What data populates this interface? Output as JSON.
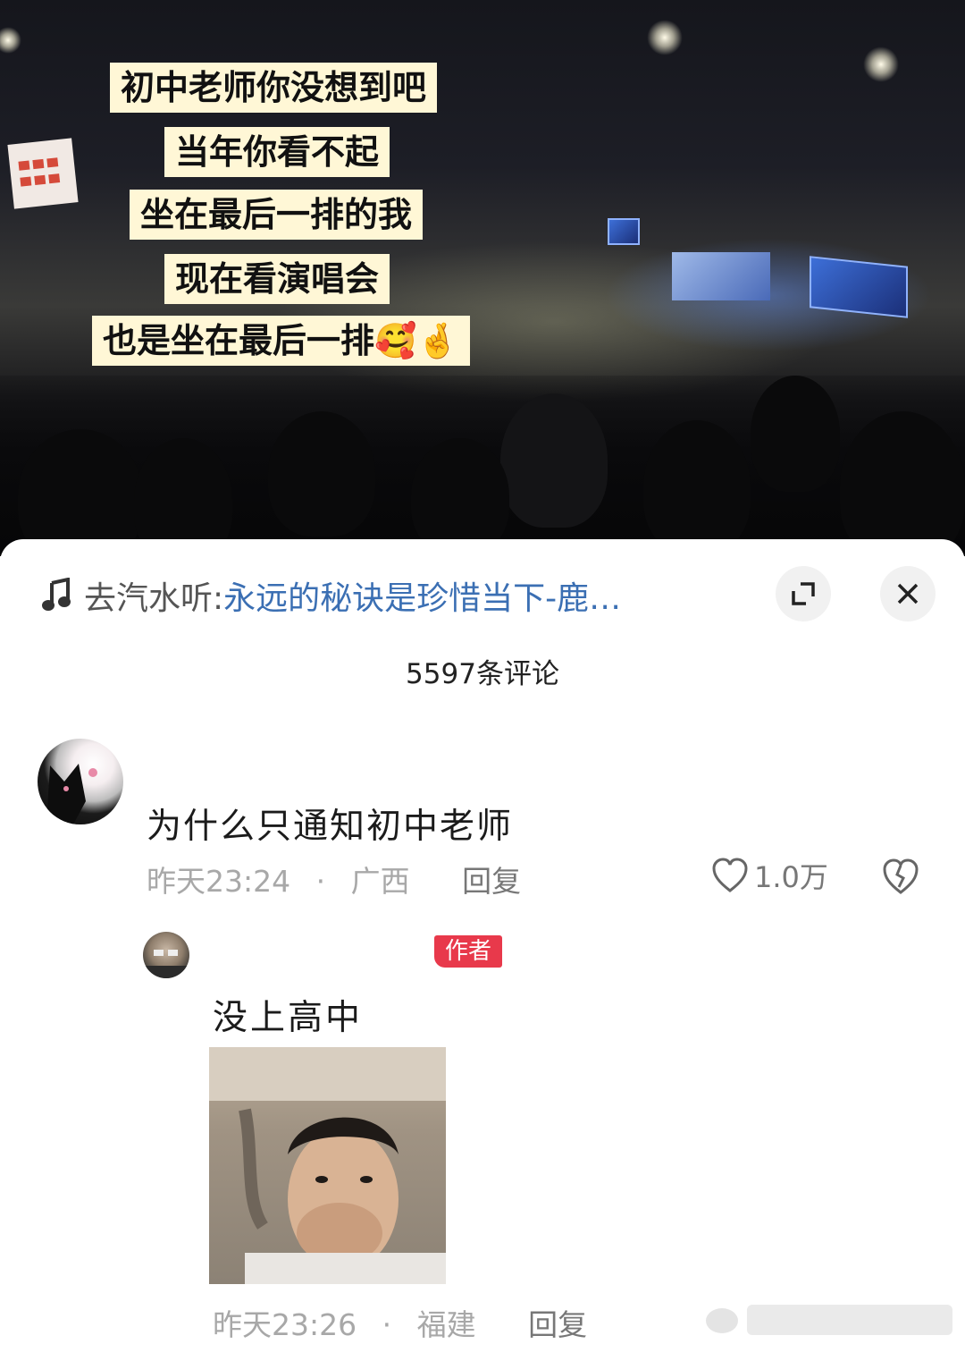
{
  "photo": {
    "captions": [
      "初中老师你没想到吧",
      "当年你看不起",
      "坐在最后一排的我",
      "现在看演唱会",
      "也是坐在最后一排🥰🤞"
    ]
  },
  "sheet": {
    "music_prefix": "去汽水听:",
    "music_title": "永远的秘诀是珍惜当下-鹿…",
    "expand_icon": "expand-icon",
    "close_icon": "close-icon",
    "comment_count": "5597条评论"
  },
  "comments": [
    {
      "text": "为什么只通知初中老师",
      "time": "昨天23:24",
      "dot": "·",
      "location": "广西",
      "reply_label": "回复",
      "likes": "1.0万"
    }
  ],
  "replies": [
    {
      "badge": "作者",
      "text": "没上高中",
      "time": "昨天23:26",
      "dot": "·",
      "location": "福建",
      "reply_label": "回复"
    }
  ],
  "colors": {
    "link": "#3b6fb3",
    "badge": "#e8394b",
    "caption_bg": "#fff7d6",
    "meta": "#a8a8a8"
  }
}
